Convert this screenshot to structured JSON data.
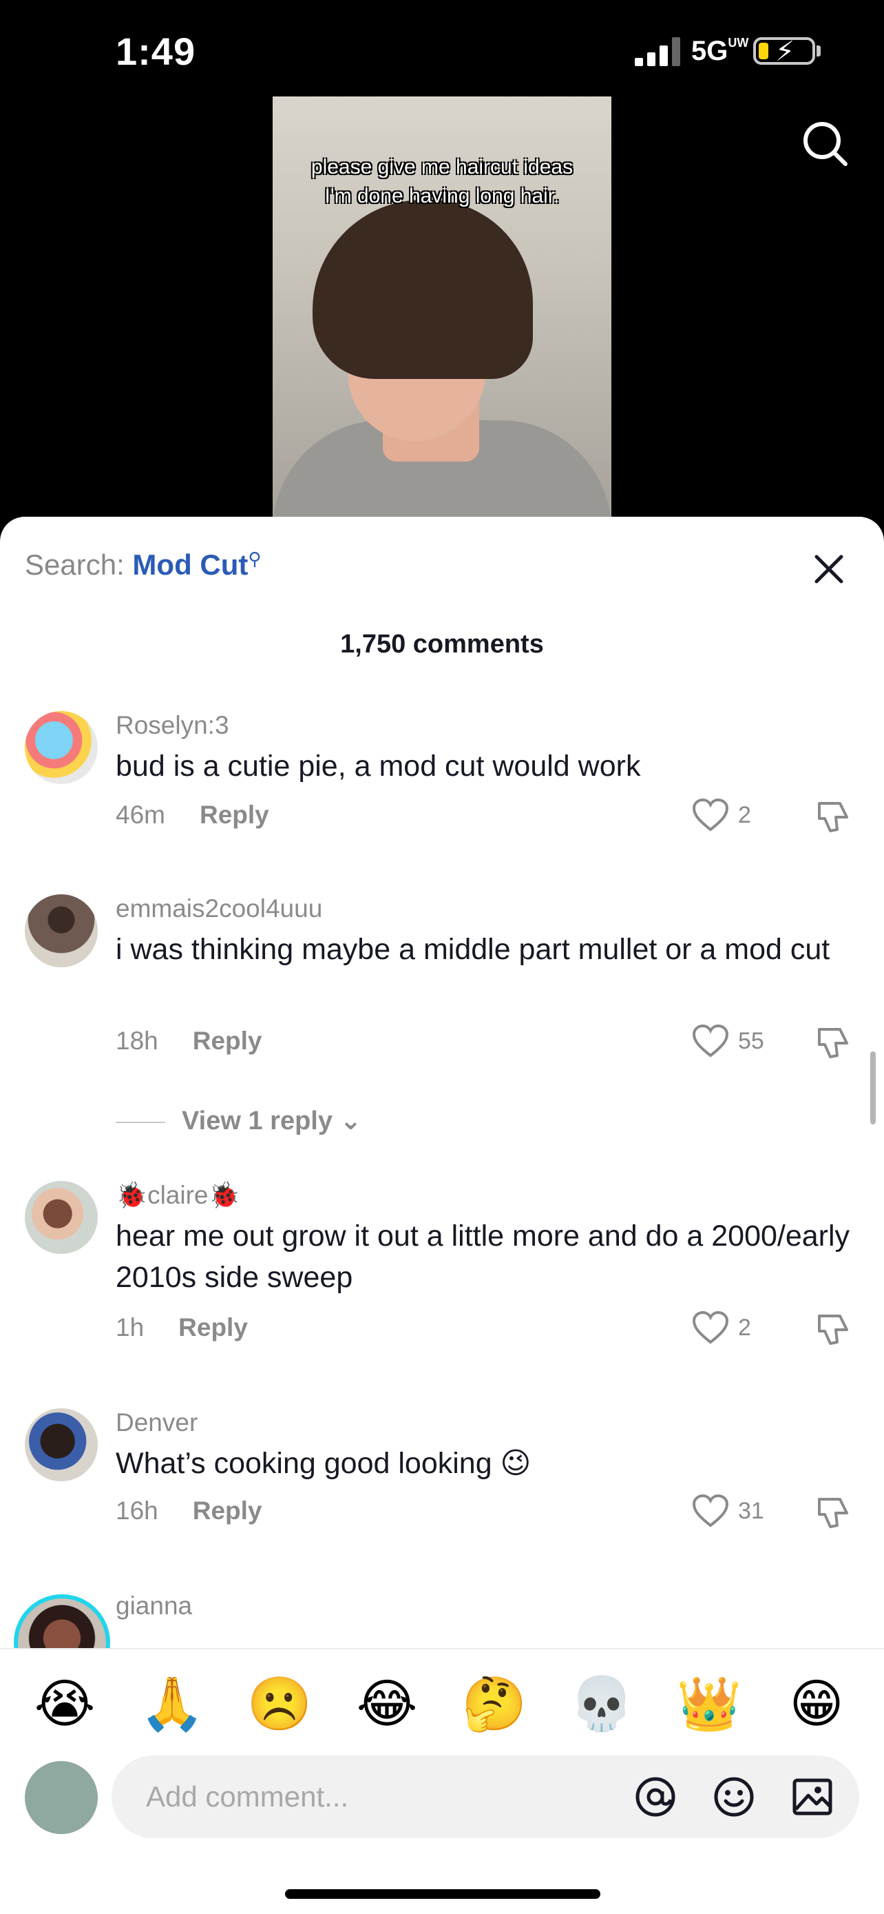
{
  "status": {
    "time": "1:49",
    "network": "5G",
    "network_sup": "UW"
  },
  "video": {
    "caption_line1": "please give me haircut ideas",
    "caption_line2": "I'm done having long hair."
  },
  "sheet": {
    "search_prefix": "Search: ",
    "search_term": "Mod Cut",
    "comment_count": "1,750 comments",
    "view_replies": "View 1 reply"
  },
  "comments": [
    {
      "username": "Roselyn:3",
      "text": "bud is a cutie pie, a mod cut would work",
      "time": "46m",
      "reply": "Reply",
      "likes": "2"
    },
    {
      "username": "emmais2cool4uuu",
      "text": "i was thinking maybe a middle part mullet or a mod cut",
      "time": "18h",
      "reply": "Reply",
      "likes": "55"
    },
    {
      "username": "🐞claire🐞",
      "text": "hear me out grow it out a little more and do a 2000/early 2010s side sweep",
      "time": "1h",
      "reply": "Reply",
      "likes": "2"
    },
    {
      "username": "Denver",
      "text": "What’s cooking good looking 😉",
      "time": "16h",
      "reply": "Reply",
      "likes": "31"
    },
    {
      "username": "gianna"
    }
  ],
  "quick_emojis": [
    "😭",
    "🙏",
    "☹️",
    "😂",
    "🤔",
    "💀",
    "👑",
    "😁"
  ],
  "composer": {
    "placeholder": "Add comment..."
  }
}
